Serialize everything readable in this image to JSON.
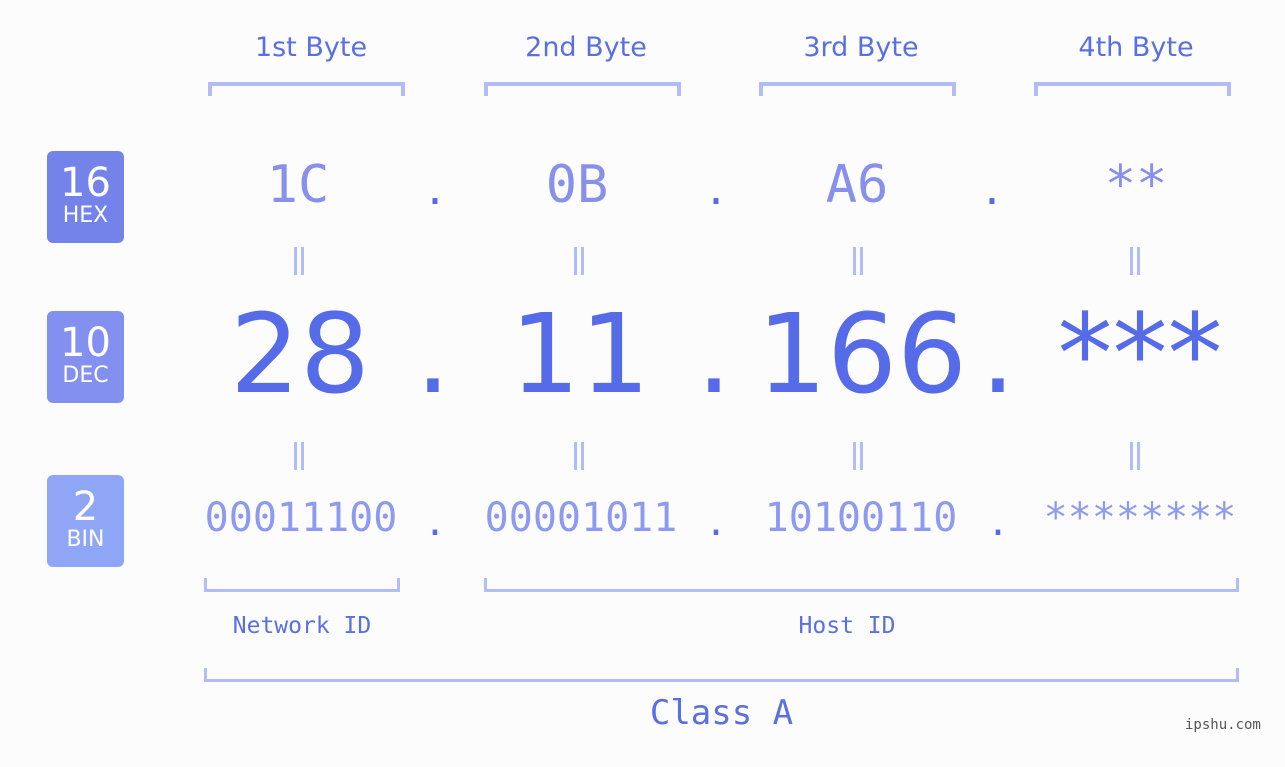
{
  "byte_headers": [
    "1st Byte",
    "2nd Byte",
    "3rd Byte",
    "4th Byte"
  ],
  "badges": [
    {
      "num": "16",
      "label": "HEX",
      "color": "#7383ea"
    },
    {
      "num": "10",
      "label": "DEC",
      "color": "#8390ef"
    },
    {
      "num": "2",
      "label": "BIN",
      "color": "#8fa6f7"
    }
  ],
  "hex": [
    "1C",
    "0B",
    "A6",
    "**"
  ],
  "dec": [
    "28",
    "11",
    "166",
    "***"
  ],
  "bin": [
    "00011100",
    "00001011",
    "10100110",
    "********"
  ],
  "separator": ".",
  "network_id_label": "Network ID",
  "host_id_label": "Host ID",
  "class_label": "Class A",
  "watermark": "ipshu.com"
}
